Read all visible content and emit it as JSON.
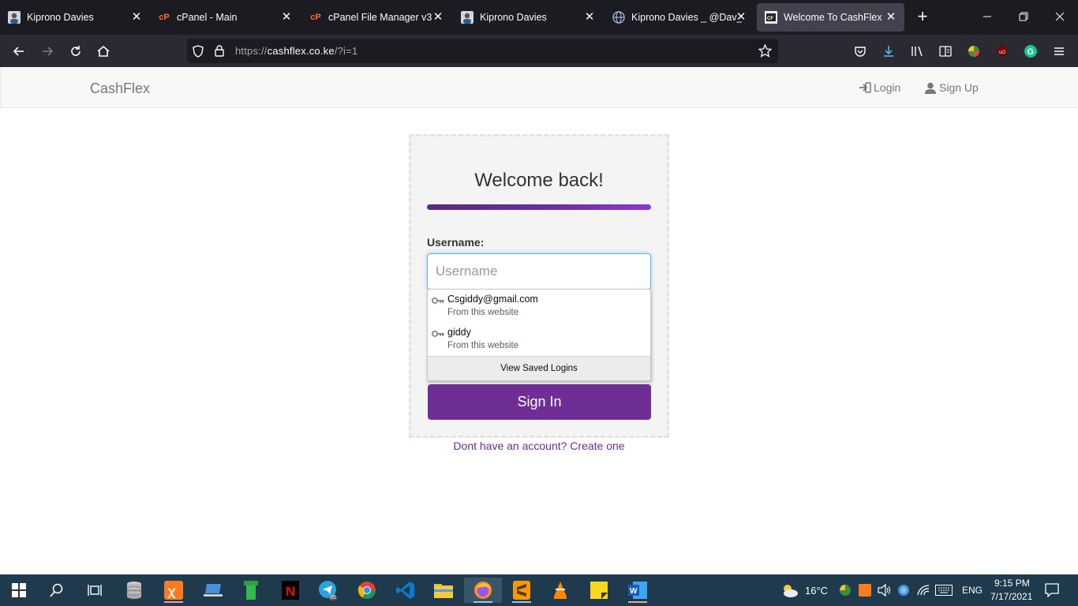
{
  "browser": {
    "tabs": [
      {
        "title": "Kiprono Davies",
        "icon": "avatar-icon"
      },
      {
        "title": "cPanel - Main",
        "icon": "cpanel-icon"
      },
      {
        "title": "cPanel File Manager v3",
        "icon": "cpanel-icon"
      },
      {
        "title": "Kiprono Davies",
        "icon": "avatar-icon"
      },
      {
        "title": "Kiprono Davies _ @Dav_e",
        "icon": "globe-icon"
      },
      {
        "title": "Welcome To CashFlex",
        "icon": "site-icon",
        "active": true
      }
    ],
    "url": {
      "prefix": "https://",
      "host": "cashflex.co.ke",
      "path": "/?i=1"
    }
  },
  "site": {
    "brand": "CashFlex",
    "nav": {
      "login": "Login",
      "signup": "Sign Up"
    },
    "accent_color": "#6f2d96"
  },
  "login": {
    "title": "Welcome back!",
    "username_label": "Username:",
    "username_placeholder": "Username",
    "username_value": "",
    "signin_label": "Sign In",
    "create_account": "Dont have an account? Create one"
  },
  "autocomplete": {
    "items": [
      {
        "username": "Csgiddy@gmail.com",
        "source": "From this website"
      },
      {
        "username": "giddy",
        "source": "From this website"
      }
    ],
    "footer": "View Saved Logins"
  },
  "taskbar": {
    "weather": "16°C",
    "language": "ENG",
    "time": "9:15 PM",
    "date": "7/17/2021",
    "telegram_badge": "85"
  }
}
